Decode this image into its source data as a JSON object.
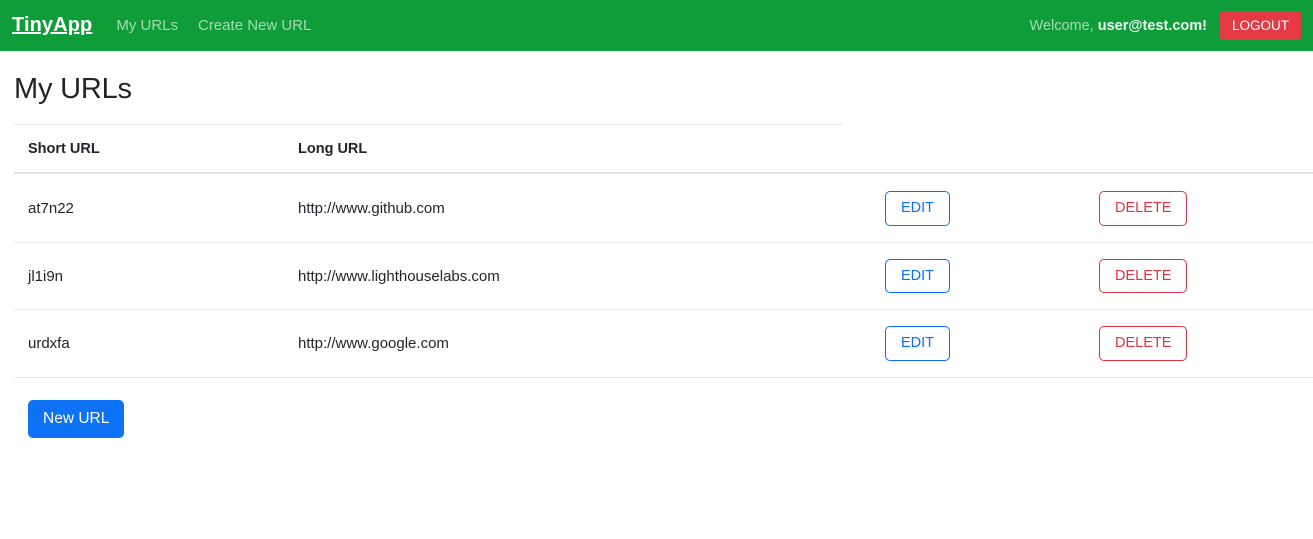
{
  "navbar": {
    "brand": "TinyApp",
    "links": [
      {
        "label": "My URLs"
      },
      {
        "label": "Create New URL"
      }
    ],
    "welcome_prefix": "Welcome,",
    "user_email": "user@test.com!",
    "logout_label": "LOGOUT",
    "background_color": "#0f9d3a",
    "logout_color": "#e63946"
  },
  "page": {
    "title": "My URLs"
  },
  "table": {
    "headers": {
      "short_url": "Short URL",
      "long_url": "Long URL",
      "edit": "",
      "delete": ""
    },
    "rows": [
      {
        "short_url": "at7n22",
        "long_url": "http://www.github.com",
        "edit_label": "EDIT",
        "delete_label": "DELETE"
      },
      {
        "short_url": "jl1i9n",
        "long_url": "http://www.lighthouselabs.com",
        "edit_label": "EDIT",
        "delete_label": "DELETE"
      },
      {
        "short_url": "urdxfa",
        "long_url": "http://www.google.com",
        "edit_label": "EDIT",
        "delete_label": "DELETE"
      }
    ]
  },
  "actions": {
    "new_url_label": "New URL",
    "new_url_color": "#0d72f5",
    "edit_color": "#0d6efd",
    "delete_color": "#dc3545"
  }
}
